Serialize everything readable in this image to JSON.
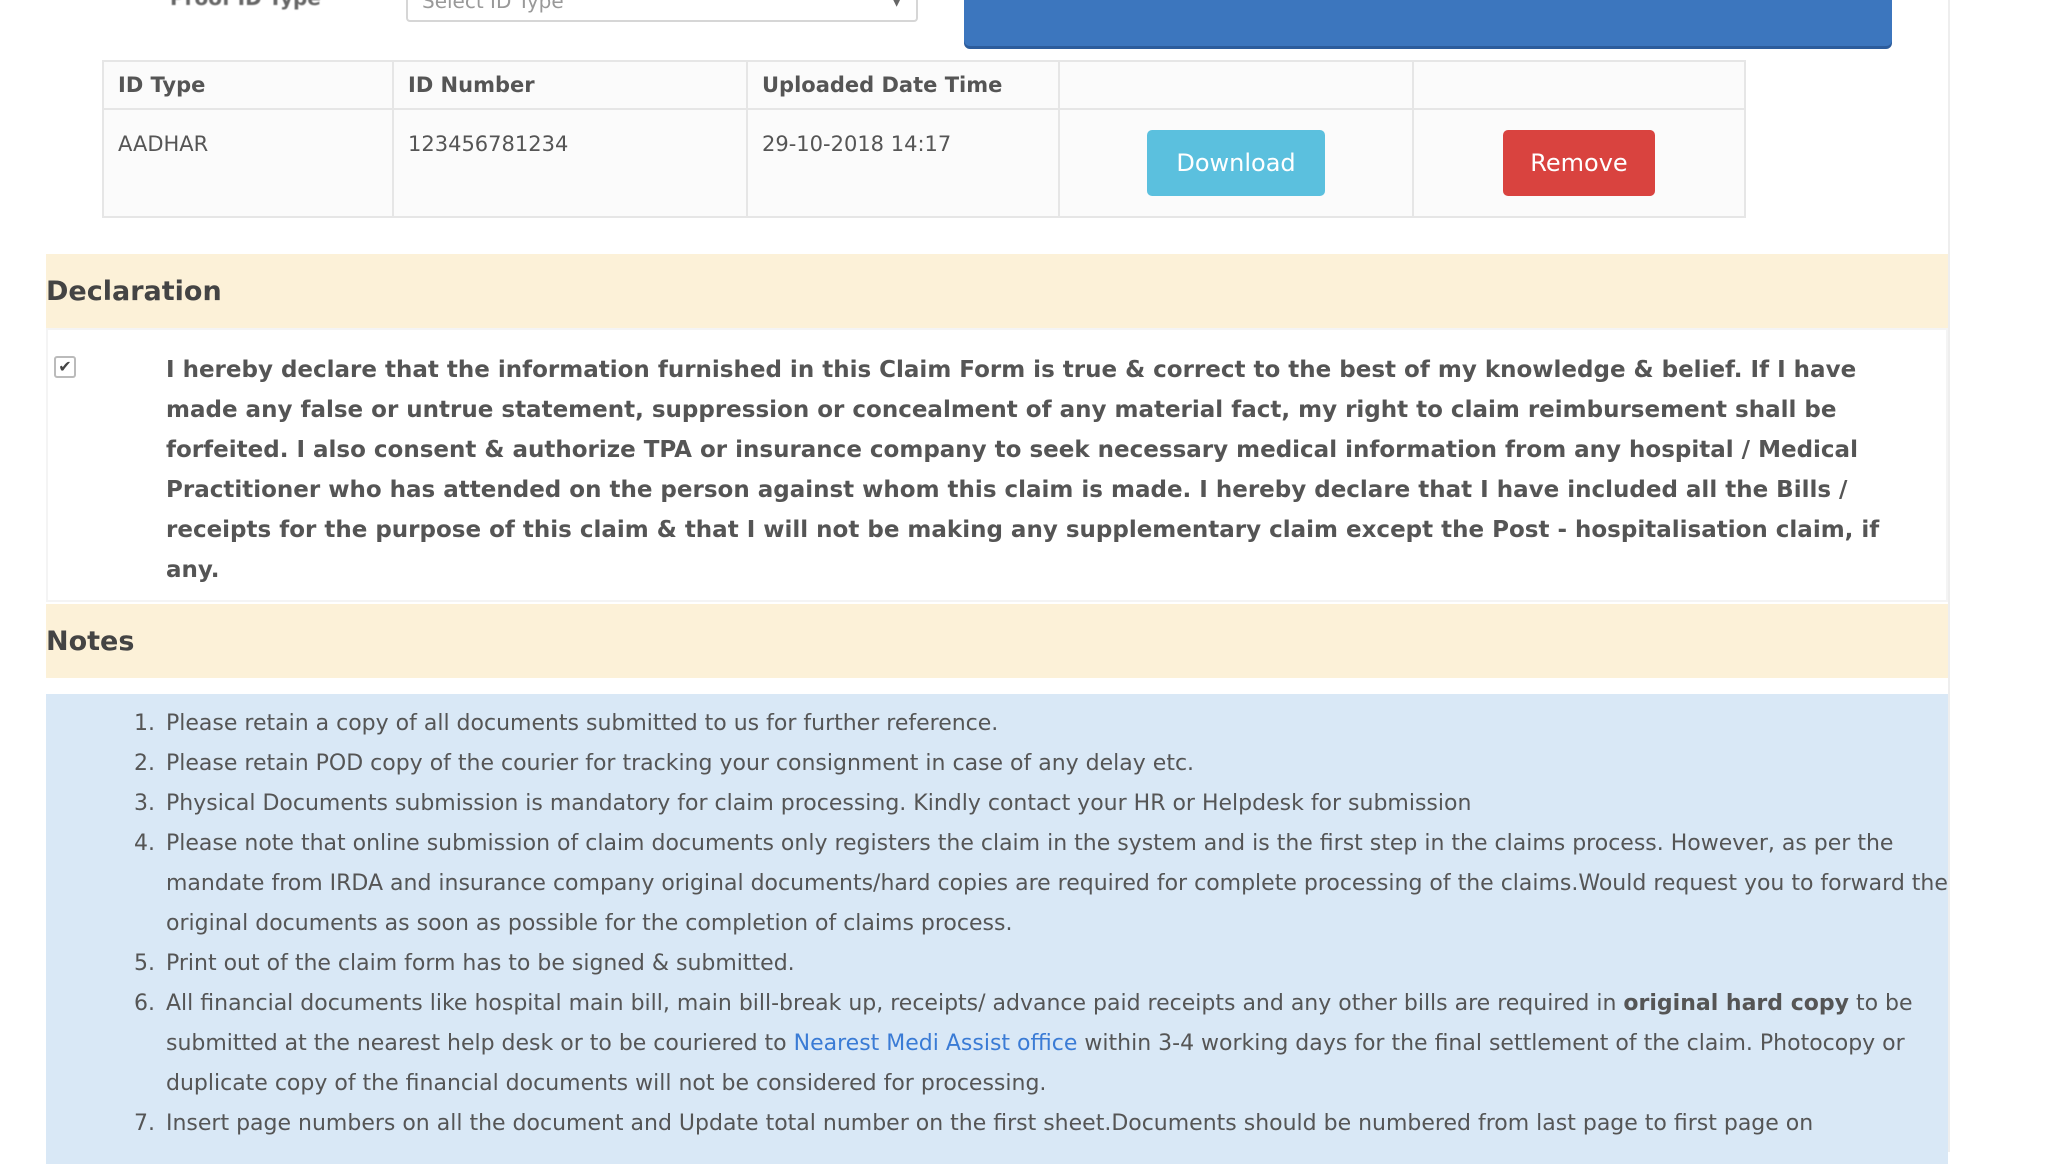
{
  "form": {
    "id_type_label": "Proof ID Type",
    "id_type_placeholder": "Select ID Type"
  },
  "table": {
    "headers": [
      "ID Type",
      "ID Number",
      "Uploaded Date Time",
      "",
      ""
    ],
    "rows": [
      {
        "id_type": "AADHAR",
        "id_number": "123456781234",
        "uploaded": "29-10-2018 14:17",
        "download_label": "Download",
        "remove_label": "Remove"
      }
    ]
  },
  "declaration": {
    "title": "Declaration",
    "checked": true,
    "text": "I hereby declare that the information furnished in this Claim Form is true & correct to the best of my knowledge & belief. If I have made any false or untrue statement, suppression or concealment of any material fact, my right to claim reimbursement shall be forfeited. I also consent & authorize TPA or insurance company to seek necessary medical information from any hospital / Medical Practitioner who has attended on the person against whom this claim is made. I hereby declare that I have included all the Bills / receipts for the purpose of this claim & that I will not be making any supplementary claim except the Post - hospitalisation claim, if any."
  },
  "notes": {
    "title": "Notes",
    "n1": "Please retain a copy of all documents submitted to us for further reference.",
    "n2": "Please retain POD copy of the courier for tracking your consignment in case of any delay etc.",
    "n3": "Physical Documents submission is mandatory for claim processing. Kindly contact your HR or Helpdesk for submission",
    "n4": "Please note that online submission of claim documents only registers the claim in the system and is the first step in the claims process. However, as per the mandate from IRDA and insurance company original documents/hard copies are required for complete processing of the claims.Would request you to forward the original documents as soon as possible for the completion of claims process.",
    "n5": "Print out of the claim form has to be signed & submitted.",
    "n6_a": "All financial documents like hospital main bill, main bill-break up, receipts/ advance paid receipts and any other bills are required in",
    "n6_bold": "original hard copy",
    "n6_b": "to be submitted at the nearest help desk or to be couriered to",
    "n6_link": "Nearest Medi Assist office",
    "n6_c": "within 3-4 working days for the final settlement of the claim. Photocopy or duplicate copy of the financial documents will not be considered for processing.",
    "n7": "Insert page numbers on all the document and Update total number on the first sheet.Documents should be numbered from last page to first page on"
  },
  "colors": {
    "accent_blue": "#3c76be",
    "download": "#5bc0de",
    "remove": "#d9433f",
    "section_head_bg": "#fcf1d8",
    "notes_bg": "#d9e8f6"
  }
}
